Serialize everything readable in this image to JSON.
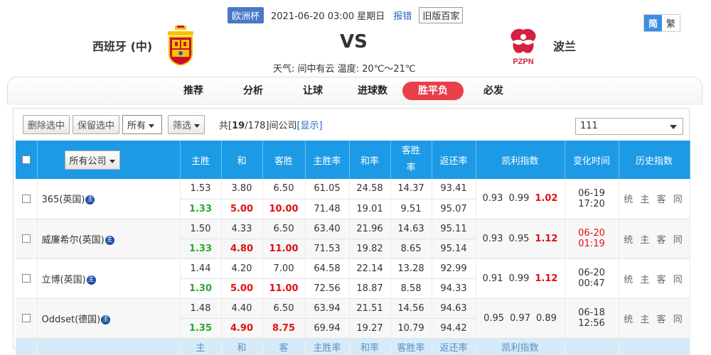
{
  "match": {
    "cup": "欧洲杯",
    "datetime": "2021-06-20 03:00 星期日",
    "report": "报错",
    "old_version": "旧版百家",
    "home": "西班牙 (中)",
    "away": "波兰",
    "vs": "VS",
    "weather": "天气: 间中有云  温度: 20℃～21℃",
    "away_crest_text": "PZPN"
  },
  "lang": {
    "simplified": "简",
    "traditional": "繁"
  },
  "nav": [
    "推荐",
    "分析",
    "让球",
    "进球数",
    "胜平负",
    "必发"
  ],
  "nav_active": 4,
  "toolbar": {
    "delete": "删除选中",
    "keep": "保留选中",
    "filter_all": "所有",
    "filter": "筛选",
    "count_prefix": "共[",
    "count_shown": "19",
    "count_total": "/178]间公司",
    "show_link": "[显示]",
    "company_select": "111"
  },
  "table": {
    "all_companies": "所有公司",
    "headers": [
      "主胜",
      "和",
      "客胜",
      "主胜率",
      "和率",
      "客胜率",
      "返还率",
      "凯利指数",
      "变化时间",
      "历史指数"
    ],
    "footer": [
      "主",
      "和",
      "客",
      "主胜率",
      "和率",
      "客胜率",
      "返还率",
      "凯利指数"
    ],
    "history_label": "统 主 客 同",
    "rows": [
      {
        "name": "365(英国)",
        "badge": "主",
        "open": [
          "1.53",
          "3.80",
          "6.50",
          "61.05",
          "24.58",
          "14.37",
          "93.41"
        ],
        "live": [
          "1.33",
          "5.00",
          "10.00",
          "71.48",
          "19.01",
          "9.51",
          "95.07"
        ],
        "kelly": [
          "0.93",
          "0.99",
          "1.02"
        ],
        "kelly_red": [
          false,
          false,
          true
        ],
        "time": "06-19 17:20",
        "time_red": false
      },
      {
        "name": "威廉希尔(英国)",
        "badge": "主",
        "open": [
          "1.50",
          "4.33",
          "6.50",
          "63.40",
          "21.96",
          "14.63",
          "95.11"
        ],
        "live": [
          "1.33",
          "4.80",
          "11.00",
          "71.53",
          "19.82",
          "8.65",
          "95.14"
        ],
        "kelly": [
          "0.93",
          "0.95",
          "1.12"
        ],
        "kelly_red": [
          false,
          false,
          true
        ],
        "time": "06-20 01:19",
        "time_red": true
      },
      {
        "name": "立博(英国)",
        "badge": "主",
        "open": [
          "1.44",
          "4.20",
          "7.00",
          "64.58",
          "22.14",
          "13.28",
          "92.99"
        ],
        "live": [
          "1.30",
          "5.00",
          "11.00",
          "72.56",
          "18.87",
          "8.58",
          "94.33"
        ],
        "kelly": [
          "0.91",
          "0.99",
          "1.12"
        ],
        "kelly_red": [
          false,
          false,
          true
        ],
        "time": "06-20 00:47",
        "time_red": false
      },
      {
        "name": "Oddset(德国)",
        "badge": "主",
        "open": [
          "1.48",
          "4.40",
          "6.50",
          "63.94",
          "21.51",
          "14.56",
          "94.63"
        ],
        "live": [
          "1.35",
          "4.90",
          "8.75",
          "69.94",
          "19.27",
          "10.79",
          "94.42"
        ],
        "kelly": [
          "0.95",
          "0.97",
          "0.89"
        ],
        "kelly_red": [
          false,
          false,
          false
        ],
        "time": "06-18 12:56",
        "time_red": false
      }
    ]
  },
  "colors": {
    "header_blue": "#1c9ae6",
    "active_tab": "#e8404a",
    "up": "#e01010",
    "down": "#2aa832"
  }
}
